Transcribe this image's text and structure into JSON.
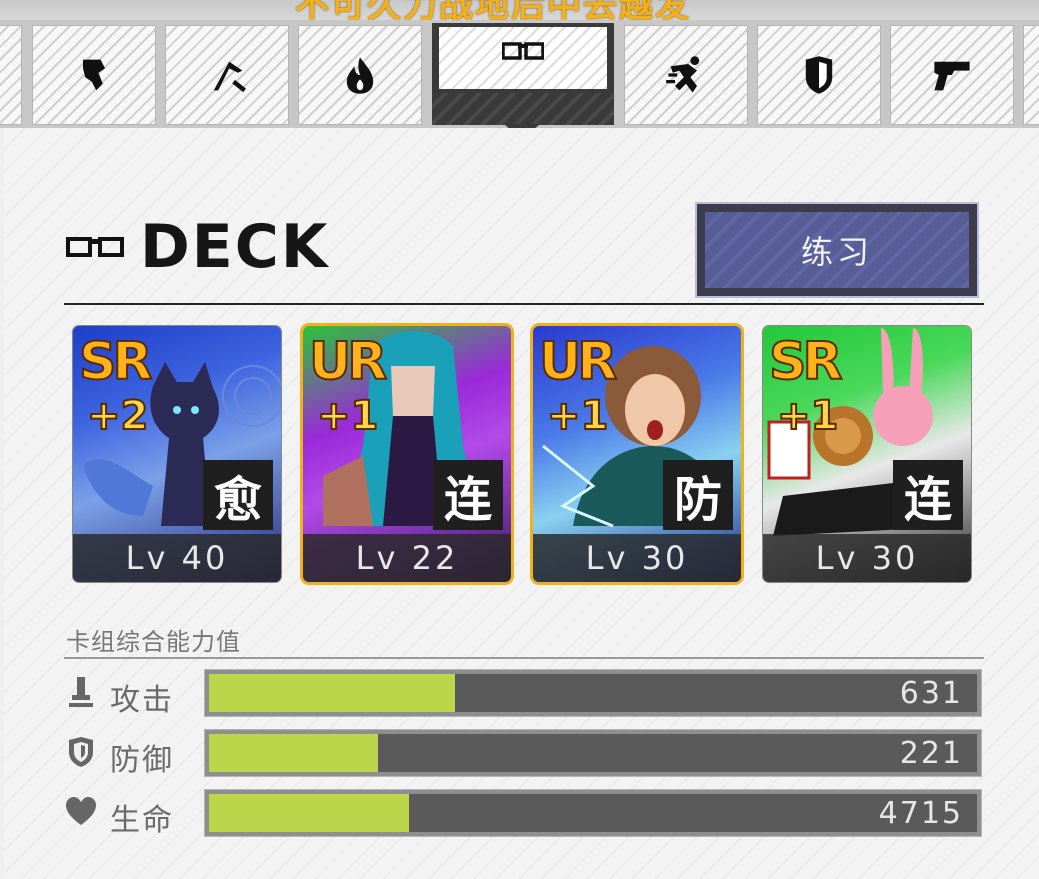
{
  "top_banner": {
    "text": "不可久力战地后中去越发"
  },
  "tabs": [
    {
      "icon": "partial-tab-edge"
    },
    {
      "icon": "fist-icon"
    },
    {
      "icon": "scythe-icon"
    },
    {
      "icon": "flame-icon"
    },
    {
      "icon": "glasses-icon",
      "active": true
    },
    {
      "icon": "running-person-icon"
    },
    {
      "icon": "shield-icon"
    },
    {
      "icon": "gun-icon"
    },
    {
      "icon": "partial-tab-edge"
    }
  ],
  "deck": {
    "title": "DECK",
    "icon": "glasses-icon",
    "practice_button": "练习"
  },
  "cards": [
    {
      "rarity": "SR",
      "plus": "+2",
      "type": "愈",
      "level": "Lv 40",
      "rarity_color": "#ffb21a",
      "bg_colors": [
        "#1e3ec8",
        "#7aa0e8",
        "#2a2a7a"
      ]
    },
    {
      "rarity": "UR",
      "plus": "+1",
      "type": "连",
      "level": "Lv 22",
      "rarity_color": "#ffb21a",
      "bg_colors": [
        "#9a2ad8",
        "#20c8d0",
        "#3a1a6a"
      ]
    },
    {
      "rarity": "UR",
      "plus": "+1",
      "type": "防",
      "level": "Lv 30",
      "rarity_color": "#ffb21a",
      "bg_colors": [
        "#2a3ad0",
        "#8ad0f0",
        "#1a2a8a"
      ]
    },
    {
      "rarity": "SR",
      "plus": "+1",
      "type": "连",
      "level": "Lv 30",
      "rarity_color": "#ffb21a",
      "bg_colors": [
        "#22c83a",
        "#f0f0f0",
        "#2a8a2a"
      ]
    }
  ],
  "stats": {
    "title": "卡组综合能力值",
    "rows": [
      {
        "icon": "attack-icon",
        "label": "攻击",
        "value": "631",
        "fill_fraction": 0.32
      },
      {
        "icon": "defense-shield-icon",
        "label": "防御",
        "value": "221",
        "fill_fraction": 0.22
      },
      {
        "icon": "heart-icon",
        "label": "生命",
        "value": "4715",
        "fill_fraction": 0.26
      }
    ]
  },
  "colors": {
    "accent_fill": "#bcd64b",
    "practice_button": "#565d97",
    "rarity_gold": "#ffb21a"
  }
}
